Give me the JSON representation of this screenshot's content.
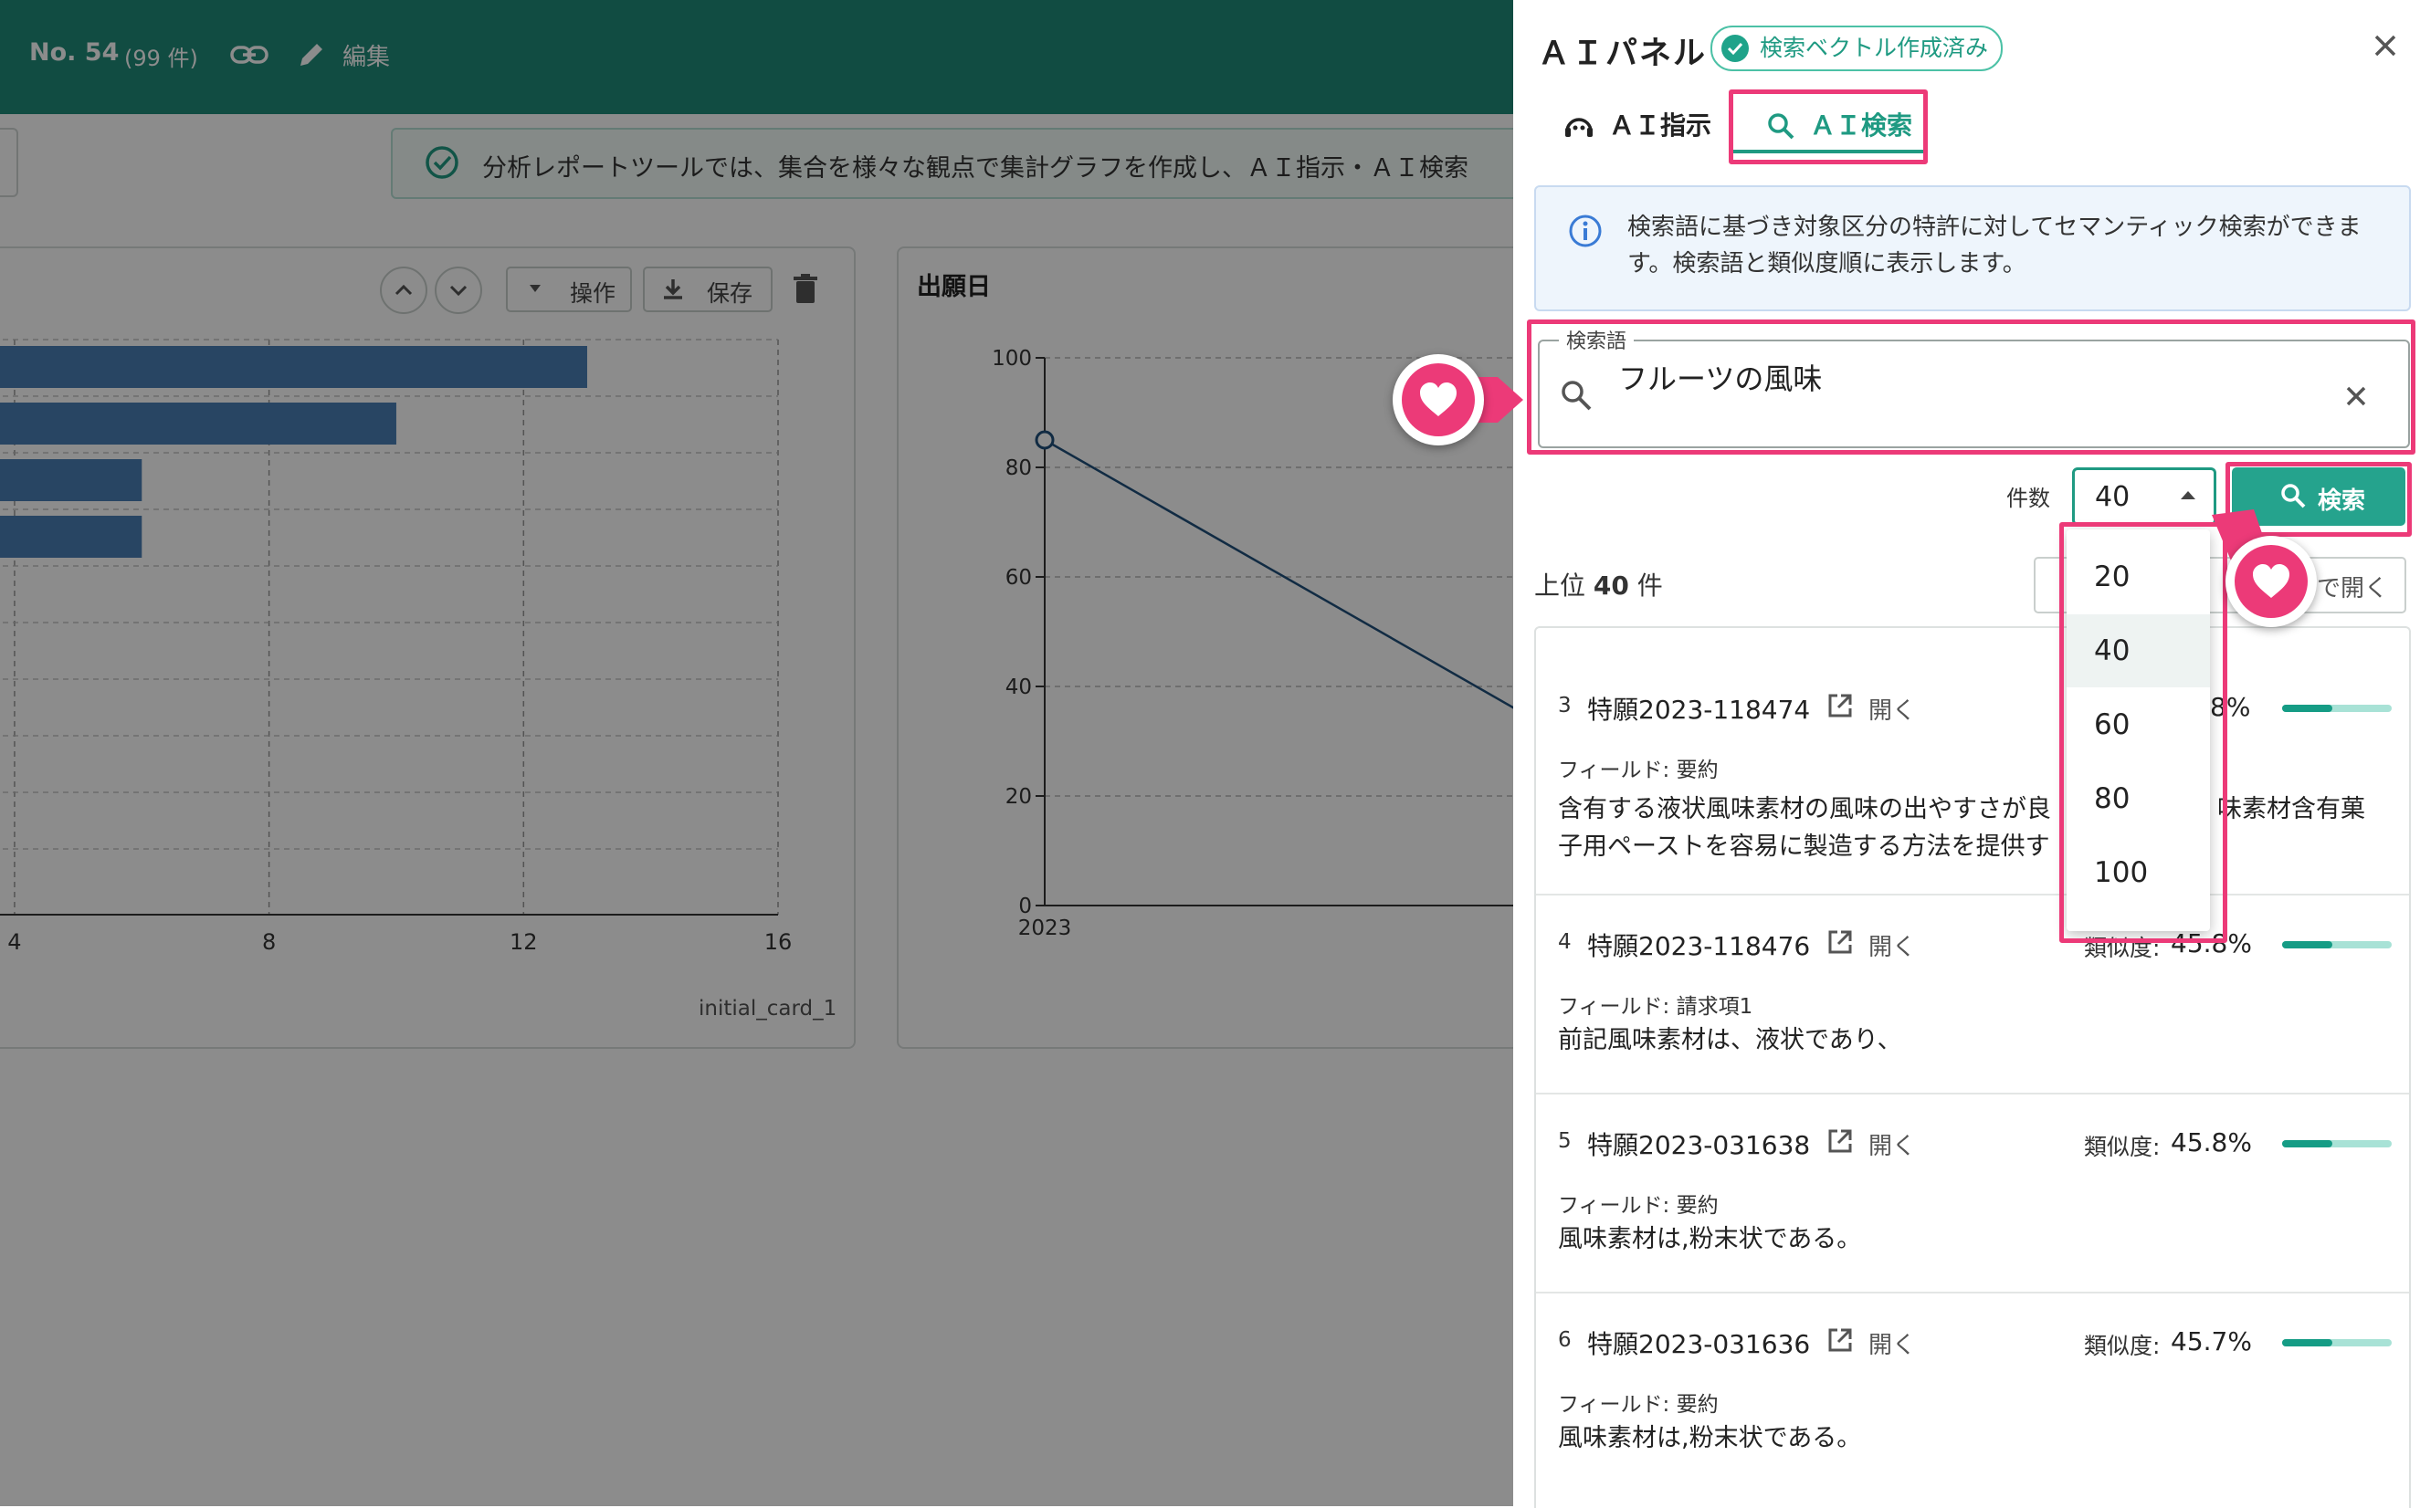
{
  "header": {
    "doc_no": "No. 54",
    "count": "(99 件)",
    "edit_label": "編集"
  },
  "notice": {
    "text": "分析レポートツールでは、集合を様々な観点で集計グラフを作成し、ＡＩ指示・ＡＩ検索"
  },
  "card1": {
    "ops_label": "操作",
    "save_label": "保存",
    "footer_label": "initial_card_1",
    "x_ticks": [
      "4",
      "8",
      "12",
      "16"
    ]
  },
  "card2": {
    "title": "出願日",
    "y_ticks": [
      "100",
      "80",
      "60",
      "40",
      "20",
      "0"
    ],
    "x_tick": "2023"
  },
  "chart_data": [
    {
      "type": "bar",
      "orientation": "horizontal",
      "values": [
        13,
        10,
        6,
        6,
        0.1
      ],
      "xlim": [
        0,
        16
      ],
      "x_ticks": [
        4,
        8,
        12,
        16
      ],
      "grid": true,
      "footer": "initial_card_1"
    },
    {
      "type": "line",
      "title": "出願日",
      "x": [
        "2023"
      ],
      "values": [
        85
      ],
      "ylim": [
        0,
        100
      ],
      "y_ticks": [
        0,
        20,
        40,
        60,
        80,
        100
      ],
      "grid": true
    }
  ],
  "panel": {
    "title": "ＡＩパネル",
    "badge": "検索ベクトル作成済み",
    "tabs": [
      {
        "label": "ＡＩ指示",
        "icon": "robot-icon"
      },
      {
        "label": "ＡＩ検索",
        "icon": "search-icon"
      }
    ],
    "active_tab": "ＡＩ検索",
    "info": "検索語に基づき対象区分の特許に対してセマンティック検索ができます。検索語と類似度順に表示します。",
    "search": {
      "legend": "検索語",
      "value": "フルーツの風味"
    },
    "count_label": "件数",
    "count_value": "40",
    "search_button": "検索",
    "top_label_prefix": "上位 ",
    "top_label_count": "40",
    "top_label_suffix": " 件",
    "open_all_label": "で開く",
    "dropdown_options": [
      "20",
      "40",
      "60",
      "80",
      "100"
    ],
    "dropdown_selected": "40"
  },
  "results": [
    {
      "num": "3",
      "id": "特願2023-118474",
      "open": "開く",
      "similarity_label": "類似度:",
      "similarity": "45.8%",
      "similarity_visible": "8%",
      "field": "フィールド: 要約",
      "text": "含有する液状風味素材の風味の出やすさが良好な味素材含有菓子用ペーストを容易に製造する方法を提供す",
      "text_line1_a": "含有する液状風味素材の風味の出やすさが良",
      "text_line1_b": "味素材含有菓",
      "text_line2": "子用ペーストを容易に製造する方法を提供す",
      "bar": 0.46
    },
    {
      "num": "4",
      "id": "特願2023-118476",
      "open": "開く",
      "similarity_label": "類似度:",
      "similarity": "45.8%",
      "field": "フィールド: 請求項1",
      "text": "前記風味素材は、液状であり、",
      "bar": 0.46
    },
    {
      "num": "5",
      "id": "特願2023-031638",
      "open": "開く",
      "similarity_label": "類似度:",
      "similarity": "45.8%",
      "field": "フィールド: 要約",
      "text": "風味素材は,粉末状である。",
      "bar": 0.46
    },
    {
      "num": "6",
      "id": "特願2023-031636",
      "open": "開く",
      "similarity_label": "類似度:",
      "similarity": "45.7%",
      "field": "フィールド: 要約",
      "text": "風味素材は,粉末状である。",
      "bar": 0.46
    }
  ],
  "colors": {
    "header_bg": "#1f8a78",
    "accent": "#1f9a82",
    "highlight": "#ec3a78",
    "bar": "#4a7fb5"
  }
}
